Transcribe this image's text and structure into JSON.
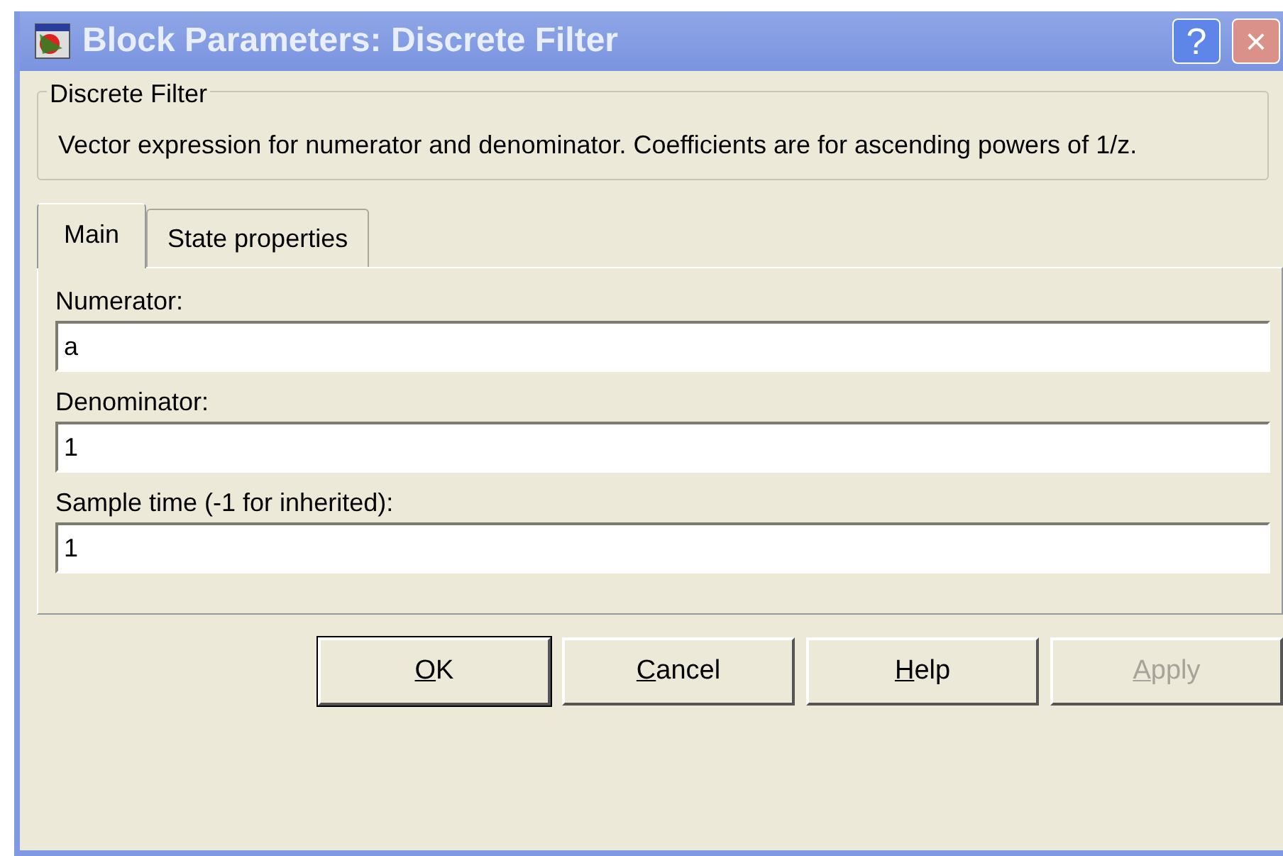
{
  "window": {
    "title": "Block Parameters: Discrete Filter",
    "controls": [
      "?",
      "×"
    ]
  },
  "group": {
    "title": "Discrete Filter",
    "description": "Vector expression for numerator and denominator.  Coefficients are for ascending powers of 1/z."
  },
  "tabs": [
    {
      "label": "Main",
      "selected": true
    },
    {
      "label": "State properties",
      "selected": false
    }
  ],
  "fields": [
    {
      "label": "Numerator:",
      "value": "a"
    },
    {
      "label": "Denominator:",
      "value": "1"
    },
    {
      "label": "Sample time (-1 for inherited):",
      "value": "1"
    }
  ],
  "buttons": [
    {
      "mnemonic": "O",
      "rest": "K",
      "disabled": false
    },
    {
      "mnemonic": "C",
      "rest": "ancel",
      "disabled": false
    },
    {
      "mnemonic": "H",
      "rest": "elp",
      "disabled": false
    },
    {
      "mnemonic": "A",
      "rest": "pply",
      "disabled": true
    }
  ]
}
